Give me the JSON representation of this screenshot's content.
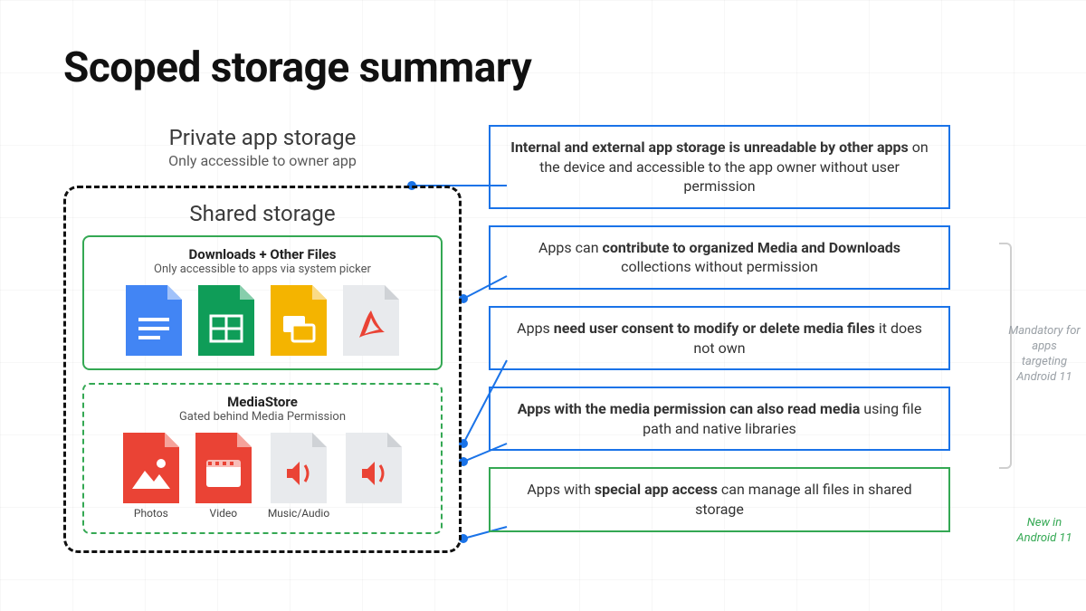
{
  "title": "Scoped storage summary",
  "left": {
    "private": {
      "title": "Private app storage",
      "subtitle": "Only accessible to owner app"
    },
    "shared": {
      "title": "Shared storage",
      "downloads": {
        "heading": "Downloads + Other Files",
        "subtitle": "Only accessible to apps via system picker",
        "icons": [
          "docs-file-icon",
          "sheets-file-icon",
          "slides-file-icon",
          "pdf-file-icon"
        ]
      },
      "mediastore": {
        "heading": "MediaStore",
        "subtitle": "Gated behind Media Permission",
        "items": [
          {
            "icon": "photo-file-icon",
            "label": "Photos"
          },
          {
            "icon": "video-file-icon",
            "label": "Video"
          },
          {
            "icon": "audio-file-icon",
            "label": "Music/Audio"
          },
          {
            "icon": "audio-file-icon-2",
            "label": ""
          }
        ]
      }
    }
  },
  "boxes": [
    {
      "html": "<b>Internal and external app storage is unreadable by other apps</b> on the device and accessible to the app owner without user permission",
      "color": "blue"
    },
    {
      "html": "Apps can <b>contribute to organized Media and Downloads</b> collections without permission",
      "color": "blue"
    },
    {
      "html": "Apps <b>need user consent to modify or delete media files</b> it does not own",
      "color": "blue"
    },
    {
      "html": "<b>Apps with the media permission can also read media</b> using file path and native libraries",
      "color": "blue"
    },
    {
      "html": "Apps with <b>special app access</b> can manage all files in shared storage",
      "color": "green"
    }
  ],
  "notes": {
    "mandatory": "Mandatory for apps targeting Android 11",
    "new": "New in Android 11"
  },
  "colors": {
    "blue": "#1a73e8",
    "green": "#34a853",
    "docs": "#4285f4",
    "sheets": "#0f9d58",
    "slides": "#f4b400",
    "gray": "#e8eaed",
    "red": "#ea4335"
  }
}
